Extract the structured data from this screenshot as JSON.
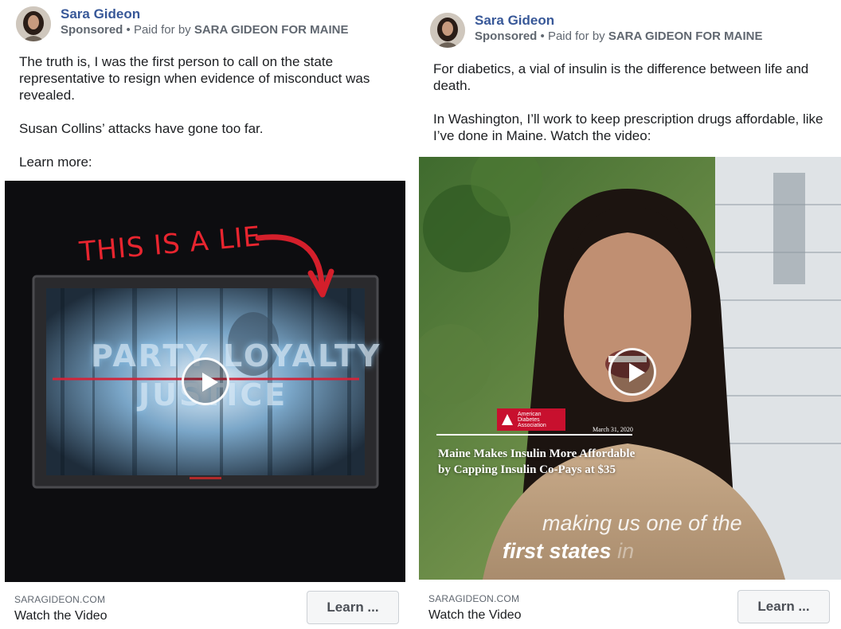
{
  "ads": [
    {
      "advertiser_name": "Sara Gideon",
      "sponsored_label": "Sponsored",
      "separator": "•",
      "paid_for_prefix": "Paid for by",
      "paid_for_by": "SARA GIDEON FOR MAINE",
      "paragraphs": [
        "The truth is, I was the first person to call on the state representative to resign when evidence of misconduct was revealed.",
        "Susan Collins’ attacks have gone too far.",
        "Learn more:"
      ],
      "video_overlay": {
        "lie_text": "THIS IS A LIE",
        "tv_line_1": "PARTY LOYALTY",
        "tv_line_2": "JUSTICE"
      },
      "link_domain": "SARAGIDEON.COM",
      "link_title": "Watch the Video",
      "cta_label": "Learn ..."
    },
    {
      "advertiser_name": "Sara Gideon",
      "sponsored_label": "Sponsored",
      "separator": "•",
      "paid_for_prefix": "Paid for by",
      "paid_for_by": "SARA GIDEON FOR MAINE",
      "paragraphs": [
        "For diabetics, a vial of insulin is the difference between life and death.",
        "In Washington, I’ll work to keep prescription drugs affordable, like I’ve done in Maine. Watch the video:"
      ],
      "video_overlay": {
        "org_name": "American Diabetes Association",
        "news_date": "March 31, 2020",
        "news_headline": "Maine Makes Insulin More Affordable by Capping Insulin Co-Pays at $35",
        "caption_line_1": "making us one of the",
        "caption_line_2": "first states",
        "caption_line_2_tail": "in"
      },
      "link_domain": "SARAGIDEON.COM",
      "link_title": "Watch the Video",
      "cta_label": "Learn ..."
    }
  ]
}
